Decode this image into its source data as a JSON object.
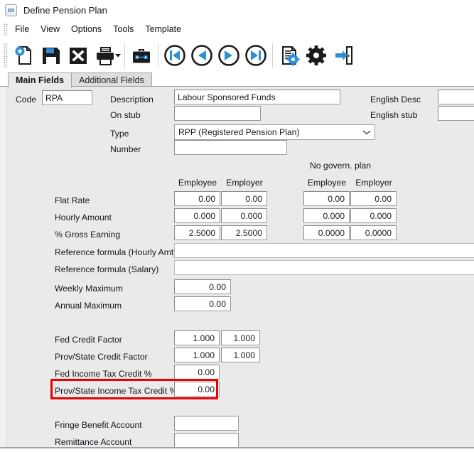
{
  "window": {
    "title": "Define Pension Plan",
    "app_icon": "m-logo-icon"
  },
  "menubar": {
    "items": [
      {
        "label": "File"
      },
      {
        "label": "View"
      },
      {
        "label": "Options"
      },
      {
        "label": "Tools"
      },
      {
        "label": "Template"
      }
    ]
  },
  "toolbar": {
    "buttons": [
      {
        "name": "new-record-button",
        "icon": "new-document-icon",
        "label": "New"
      },
      {
        "name": "save-button",
        "icon": "save-floppy-icon",
        "label": "Save"
      },
      {
        "name": "delete-button",
        "icon": "delete-x-icon",
        "label": "Delete"
      },
      {
        "name": "print-button",
        "icon": "printer-icon",
        "label": "Print"
      },
      {
        "name": "print-dropdown-button",
        "icon": "chevron-down-icon",
        "label": "Print options"
      },
      {
        "name": "briefcase-button",
        "icon": "briefcase-icon",
        "label": "Briefcase"
      },
      {
        "name": "first-record-button",
        "icon": "first-record-icon",
        "label": "First"
      },
      {
        "name": "previous-record-button",
        "icon": "previous-record-icon",
        "label": "Previous"
      },
      {
        "name": "next-record-button",
        "icon": "next-record-icon",
        "label": "Next"
      },
      {
        "name": "last-record-button",
        "icon": "last-record-icon",
        "label": "Last"
      },
      {
        "name": "report-settings-button",
        "icon": "document-gear-icon",
        "label": "Report settings"
      },
      {
        "name": "settings-button",
        "icon": "gear-icon",
        "label": "Settings"
      },
      {
        "name": "exit-button",
        "icon": "exit-door-icon",
        "label": "Exit"
      }
    ]
  },
  "tabs": [
    {
      "label": "Main Fields",
      "active": true
    },
    {
      "label": "Additional Fields",
      "active": false
    }
  ],
  "form": {
    "code": {
      "label": "Code",
      "value": "RPA"
    },
    "description": {
      "label": "Description",
      "value": "Labour Sponsored Funds"
    },
    "on_stub": {
      "label": "On stub",
      "value": ""
    },
    "type": {
      "label": "Type",
      "value": "RPP (Registered Pension Plan)"
    },
    "number": {
      "label": "Number",
      "value": ""
    },
    "english_desc": {
      "label": "English Desc",
      "value": ""
    },
    "english_stub": {
      "label": "English stub",
      "value": ""
    },
    "group_header": "No govern. plan",
    "columns": {
      "employee": "Employee",
      "employer": "Employer",
      "ng_employee": "Employee",
      "ng_employer": "Employer"
    },
    "rows": [
      {
        "label": "Flat Rate",
        "employee": "0.00",
        "employer": "0.00",
        "ng_employee": "0.00",
        "ng_employer": "0.00"
      },
      {
        "label": "Hourly Amount",
        "employee": "0.000",
        "employer": "0.000",
        "ng_employee": "0.000",
        "ng_employer": "0.000"
      },
      {
        "label": "% Gross Earning",
        "employee": "2.5000",
        "employer": "2.5000",
        "ng_employee": "0.0000",
        "ng_employer": "0.0000"
      }
    ],
    "ref_formula_hourly": {
      "label": "Reference formula (Hourly Amt)",
      "value": ""
    },
    "ref_formula_salary": {
      "label": "Reference formula (Salary)",
      "value": ""
    },
    "weekly_maximum": {
      "label": "Weekly Maximum",
      "value": "0.00"
    },
    "annual_maximum": {
      "label": "Annual Maximum",
      "value": "0.00"
    },
    "fed_credit_factor": {
      "label": "Fed Credit Factor",
      "employee": "1.000",
      "employer": "1.000"
    },
    "prov_credit_factor": {
      "label": "Prov/State Credit Factor",
      "employee": "1.000",
      "employer": "1.000"
    },
    "fed_income_tax_credit": {
      "label": "Fed Income Tax Credit %",
      "value": "0.00"
    },
    "prov_income_tax_credit": {
      "label": "Prov/State Income Tax Credit %",
      "value": "0.00"
    },
    "fringe_benefit_account": {
      "label": "Fringe Benefit Account",
      "value": ""
    },
    "remittance_account": {
      "label": "Remittance Account",
      "value": ""
    }
  },
  "annotation": {
    "highlight_color": "#ee0000",
    "highlight_target": "prov-state-income-tax-credit-row"
  }
}
